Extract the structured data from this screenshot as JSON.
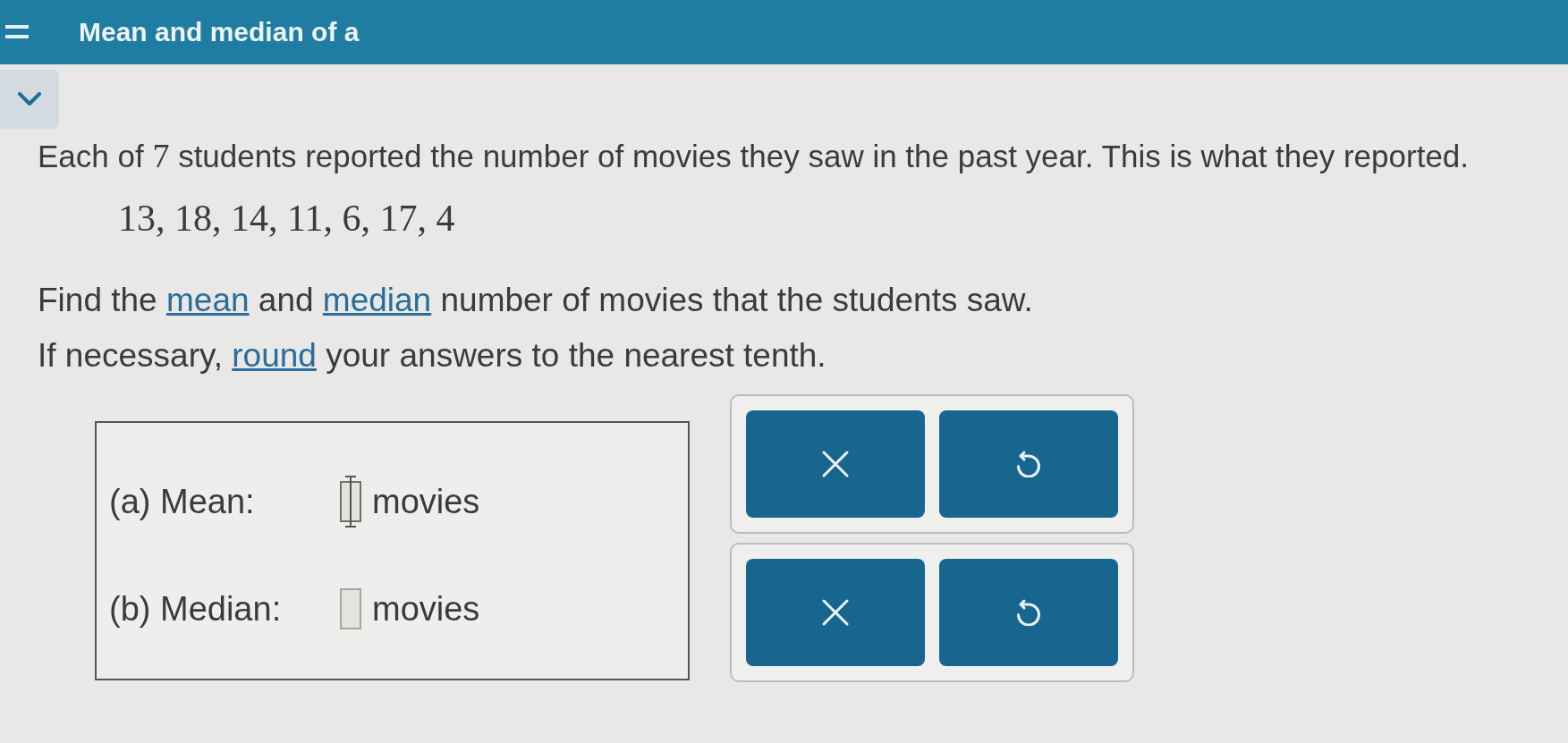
{
  "header": {
    "title": "Mean and median of a"
  },
  "problem": {
    "intro": [
      {
        "kind": "text",
        "text": "Each of "
      },
      {
        "kind": "math",
        "text": "7"
      },
      {
        "kind": "text",
        "text": " students reported the number of movies they saw in the past year. This is what they reported."
      }
    ],
    "data_values": "13, 18, 14, 11, 6, 17, 4",
    "task": [
      {
        "kind": "text",
        "text": "Find the "
      },
      {
        "kind": "link",
        "text": "mean"
      },
      {
        "kind": "text",
        "text": " and "
      },
      {
        "kind": "link",
        "text": "median"
      },
      {
        "kind": "text",
        "text": " number of movies that the students saw."
      }
    ],
    "rounding": [
      {
        "kind": "text",
        "text": "If necessary, "
      },
      {
        "kind": "link",
        "text": "round"
      },
      {
        "kind": "text",
        "text": " your answers to the nearest tenth."
      }
    ]
  },
  "answers": [
    {
      "label": "(a) Mean:",
      "unit": "movies",
      "hovered": true
    },
    {
      "label": "(b) Median:",
      "unit": "movies",
      "hovered": false
    }
  ],
  "tool_panels": [
    {
      "buttons": [
        {
          "kind": "clear"
        },
        {
          "kind": "undo"
        }
      ]
    },
    {
      "buttons": [
        {
          "kind": "clear"
        },
        {
          "kind": "undo"
        }
      ]
    }
  ]
}
